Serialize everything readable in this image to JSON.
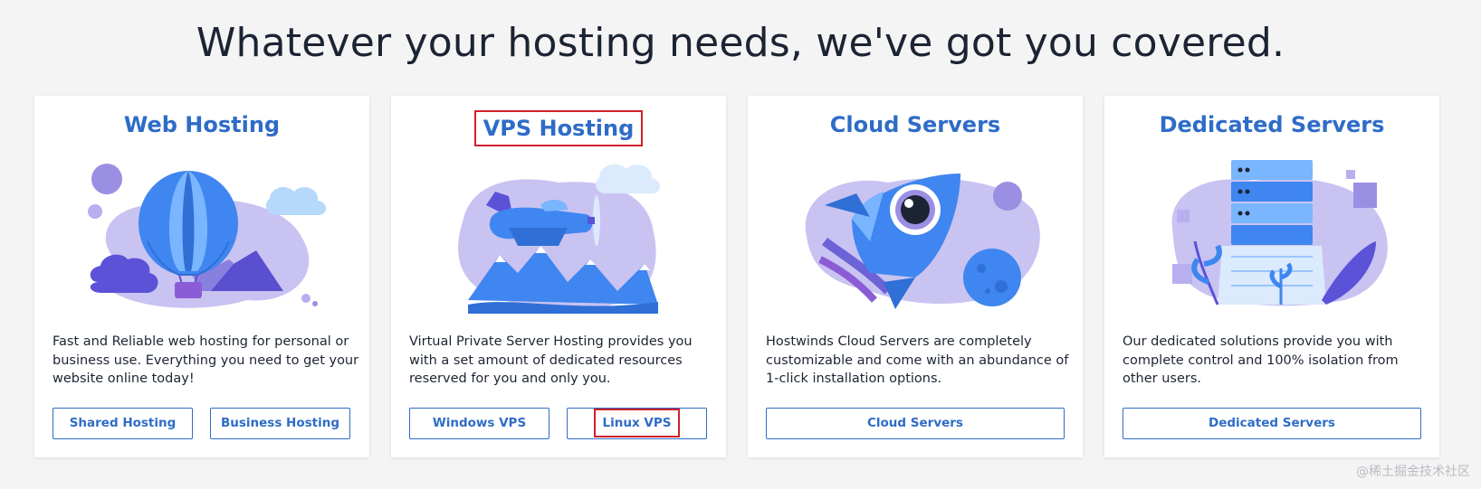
{
  "headline": "Whatever your hosting needs, we've got you covered.",
  "colors": {
    "accent": "#2e6cc7",
    "highlight_box": "#d0202a",
    "text": "#1c2433",
    "background": "#f4f4f4",
    "illustration_purple": "#9b8fe3",
    "illustration_blue": "#3f86f0"
  },
  "cards": [
    {
      "title": "Web Hosting",
      "illustration": "hot-air-balloon-illustration",
      "description": "Fast and Reliable web hosting for personal or business use. Everything you need to get your website online today!",
      "buttons": [
        "Shared Hosting",
        "Business Hosting"
      ]
    },
    {
      "title": "VPS Hosting",
      "illustration": "airplane-illustration",
      "description": "Virtual Private Server Hosting provides you with a set amount of dedicated resources reserved for you and only you.",
      "buttons": [
        "Windows VPS",
        "Linux VPS"
      ]
    },
    {
      "title": "Cloud Servers",
      "illustration": "rocket-illustration",
      "description": "Hostwinds Cloud Servers are completely customizable and come with an abundance of 1-click installation options.",
      "buttons": [
        "Cloud Servers"
      ]
    },
    {
      "title": "Dedicated Servers",
      "illustration": "server-rack-illustration",
      "description": "Our dedicated solutions provide you with complete control and 100% isolation from other users.",
      "buttons": [
        "Dedicated Servers"
      ]
    }
  ],
  "watermark": "@稀土掘金技术社区"
}
